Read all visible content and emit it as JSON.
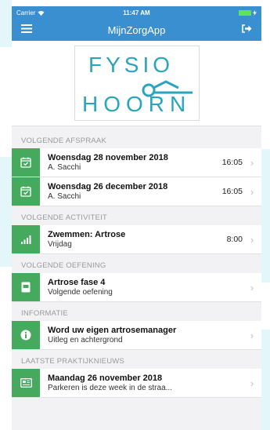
{
  "status_bar": {
    "carrier": "Carrier",
    "time": "11:47 AM"
  },
  "header": {
    "title": "MijnZorgApp",
    "menu_icon": "hamburger-icon",
    "logout_icon": "logout-icon"
  },
  "logo": {
    "line1": "FYSIO",
    "line2": "HOORN",
    "brand_color": "#2aa5bd"
  },
  "colors": {
    "header": "#3a8fd0",
    "accent": "#45aa5e"
  },
  "sections": {
    "afspraak": {
      "header": "VOLGENDE AFSPRAAK",
      "items": [
        {
          "title": "Woensdag 28 november 2018",
          "subtitle": "A. Sacchi",
          "time": "16:05",
          "icon": "calendar-check-icon"
        },
        {
          "title": "Woensdag 26 december 2018",
          "subtitle": "A. Sacchi",
          "time": "16:05",
          "icon": "calendar-check-icon"
        }
      ]
    },
    "activiteit": {
      "header": "VOLGENDE ACTIVITEIT",
      "items": [
        {
          "title": "Zwemmen: Artrose",
          "subtitle": "Vrijdag",
          "time": "8:00",
          "icon": "signal-bars-icon"
        }
      ]
    },
    "oefening": {
      "header": "VOLGENDE OEFENING",
      "items": [
        {
          "title": "Artrose fase 4",
          "subtitle": "Volgende oefening",
          "icon": "exercise-card-icon"
        }
      ]
    },
    "informatie": {
      "header": "INFORMATIE",
      "items": [
        {
          "title": "Word uw eigen artrosemanager",
          "subtitle": "Uitleg en achtergrond",
          "icon": "info-icon"
        }
      ]
    },
    "nieuws": {
      "header": "LAATSTE PRAKTIJKNIEUWS",
      "items": [
        {
          "title": "Maandag 26 november 2018",
          "subtitle": "Parkeren is deze week in de straa...",
          "icon": "newspaper-icon"
        }
      ]
    }
  }
}
